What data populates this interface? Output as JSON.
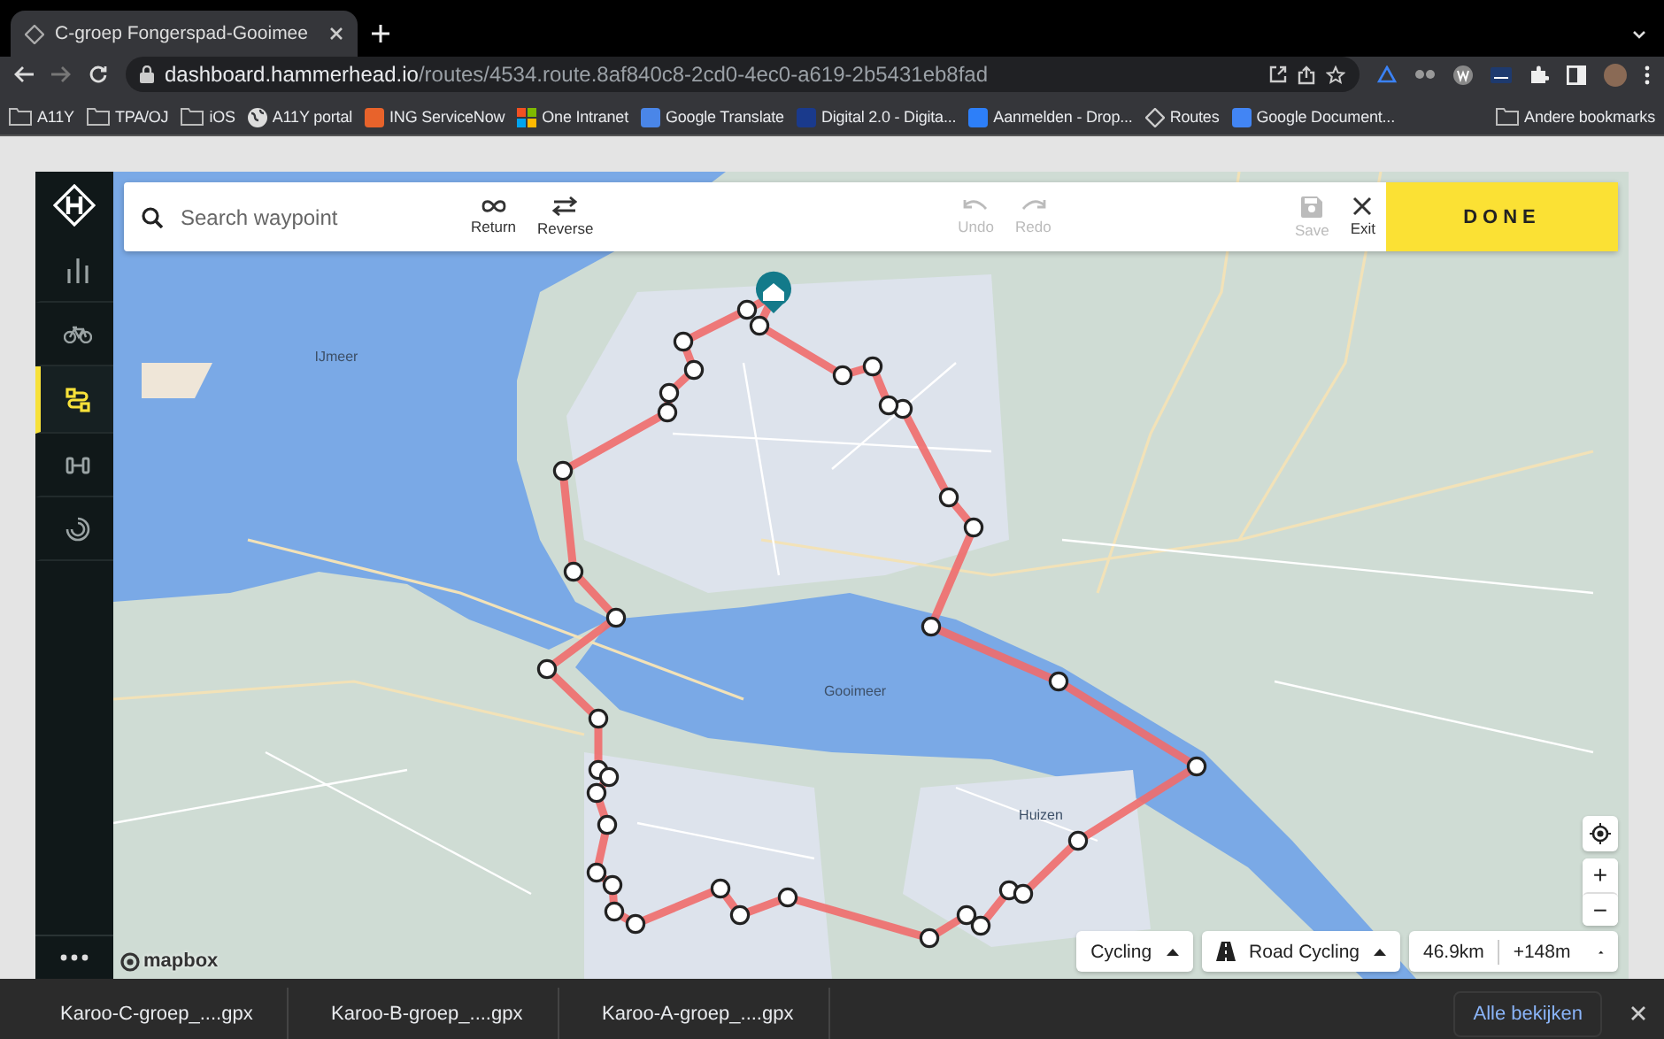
{
  "browser": {
    "tab": {
      "title": "C-groep Fongerspad-Gooimee",
      "selected": true
    },
    "url_host": "dashboard.hammerhead.io",
    "url_path": "/routes/4534.route.8af840c8-2cd0-4ec0-a619-2b5431eb8fad",
    "bookmarks": [
      {
        "label": "A11Y",
        "kind": "folder"
      },
      {
        "label": "TPA/OJ",
        "kind": "folder"
      },
      {
        "label": "iOS",
        "kind": "folder"
      },
      {
        "label": "A11Y portal",
        "kind": "globe"
      },
      {
        "label": "ING ServiceNow",
        "kind": "site",
        "color": "#e8632b"
      },
      {
        "label": "One Intranet",
        "kind": "windows"
      },
      {
        "label": "Google Translate",
        "kind": "site",
        "color": "#4a86e8"
      },
      {
        "label": "Digital 2.0 - Digita...",
        "kind": "site",
        "color": "#1a3a8c"
      },
      {
        "label": "Aanmelden - Drop...",
        "kind": "site",
        "color": "#2d7ff9"
      },
      {
        "label": "Routes",
        "kind": "logo"
      },
      {
        "label": "Google Document...",
        "kind": "site",
        "color": "#4285f4"
      }
    ],
    "other_bookmarks": "Andere bookmarks"
  },
  "sidebar": {
    "items": [
      {
        "kind": "stats",
        "selected": false
      },
      {
        "kind": "bike",
        "selected": false
      },
      {
        "kind": "route",
        "selected": true
      },
      {
        "kind": "workout",
        "selected": false
      },
      {
        "kind": "loading",
        "selected": false
      }
    ]
  },
  "toolbar": {
    "search": {
      "placeholder": "Search waypoint"
    },
    "actions": [
      {
        "label": "Return",
        "kind": "loop",
        "disabled": false
      },
      {
        "label": "Reverse",
        "kind": "reverse",
        "disabled": false
      },
      {
        "label": "Undo",
        "kind": "undo",
        "disabled": true
      },
      {
        "label": "Redo",
        "kind": "redo",
        "disabled": true
      },
      {
        "label": "Save",
        "kind": "save",
        "disabled": true
      },
      {
        "label": "Exit",
        "kind": "exit",
        "disabled": false
      }
    ],
    "done": "DONE"
  },
  "map": {
    "labels": [
      {
        "text": "IJmeer"
      },
      {
        "text": "Gooimeer"
      },
      {
        "text": "Huizen"
      }
    ],
    "attribution": "mapbox",
    "zoom_in": "+",
    "zoom_out": "−"
  },
  "route_settings": {
    "sport": "Cycling",
    "profile": "Road Cycling",
    "distance": "46.9km",
    "elevation": "+148m"
  },
  "downloads": {
    "files": [
      {
        "name": "Karoo-C-groep_....gpx"
      },
      {
        "name": "Karoo-B-groep_....gpx"
      },
      {
        "name": "Karoo-A-groep_....gpx"
      }
    ],
    "show_all": "Alle bekijken"
  }
}
